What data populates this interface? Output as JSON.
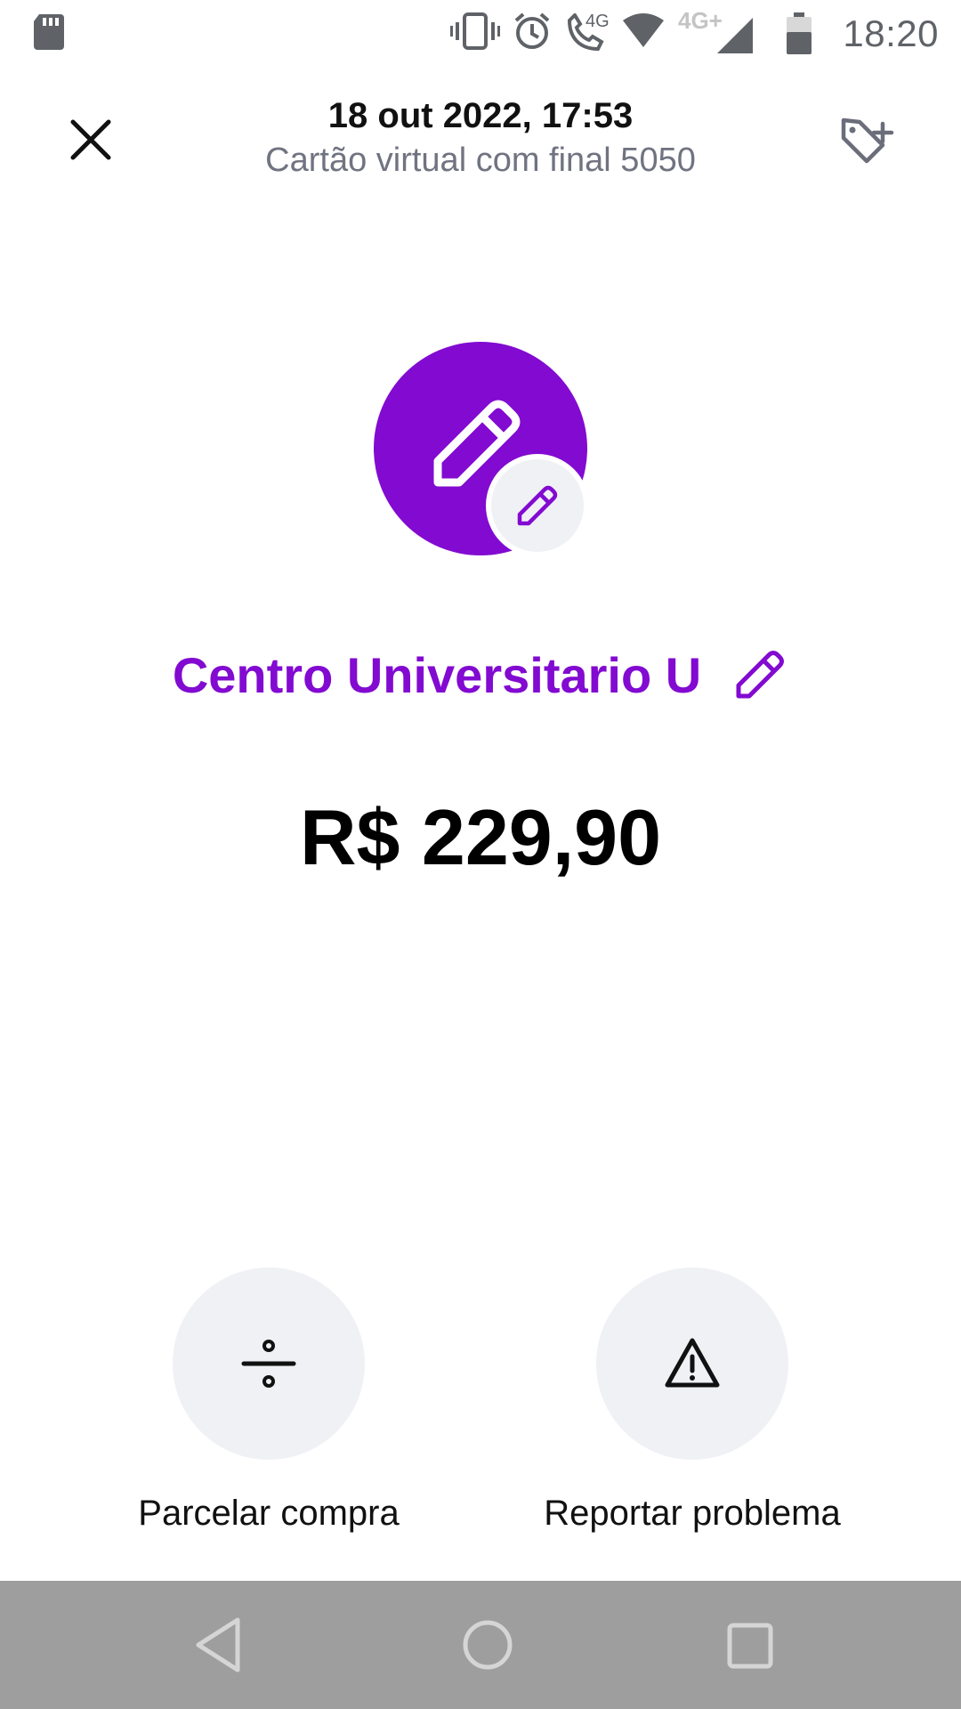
{
  "status_bar": {
    "time": "18:20",
    "icons": [
      "sd-card-icon",
      "vibrate-icon",
      "alarm-icon",
      "wifi-calling-icon",
      "wifi-icon",
      "signal-4g-plus-icon",
      "battery-icon"
    ],
    "network_label": "4G+",
    "call_label": "4G"
  },
  "header": {
    "date": "18 out 2022, 17:53",
    "subtitle": "Cartão virtual com final 5050",
    "close_icon": "close-icon",
    "tag_icon": "tag-add-icon"
  },
  "transaction": {
    "merchant": "Centro Universitario U",
    "amount": "R$ 229,90",
    "category_icon": "pencil-icon",
    "accent_color": "#820ad1"
  },
  "actions": [
    {
      "label": "Parcelar compra",
      "icon": "divide-icon"
    },
    {
      "label": "Reportar problema",
      "icon": "warning-icon"
    }
  ],
  "nav_bar": {
    "buttons": [
      "back-icon",
      "home-icon",
      "recents-icon"
    ]
  }
}
